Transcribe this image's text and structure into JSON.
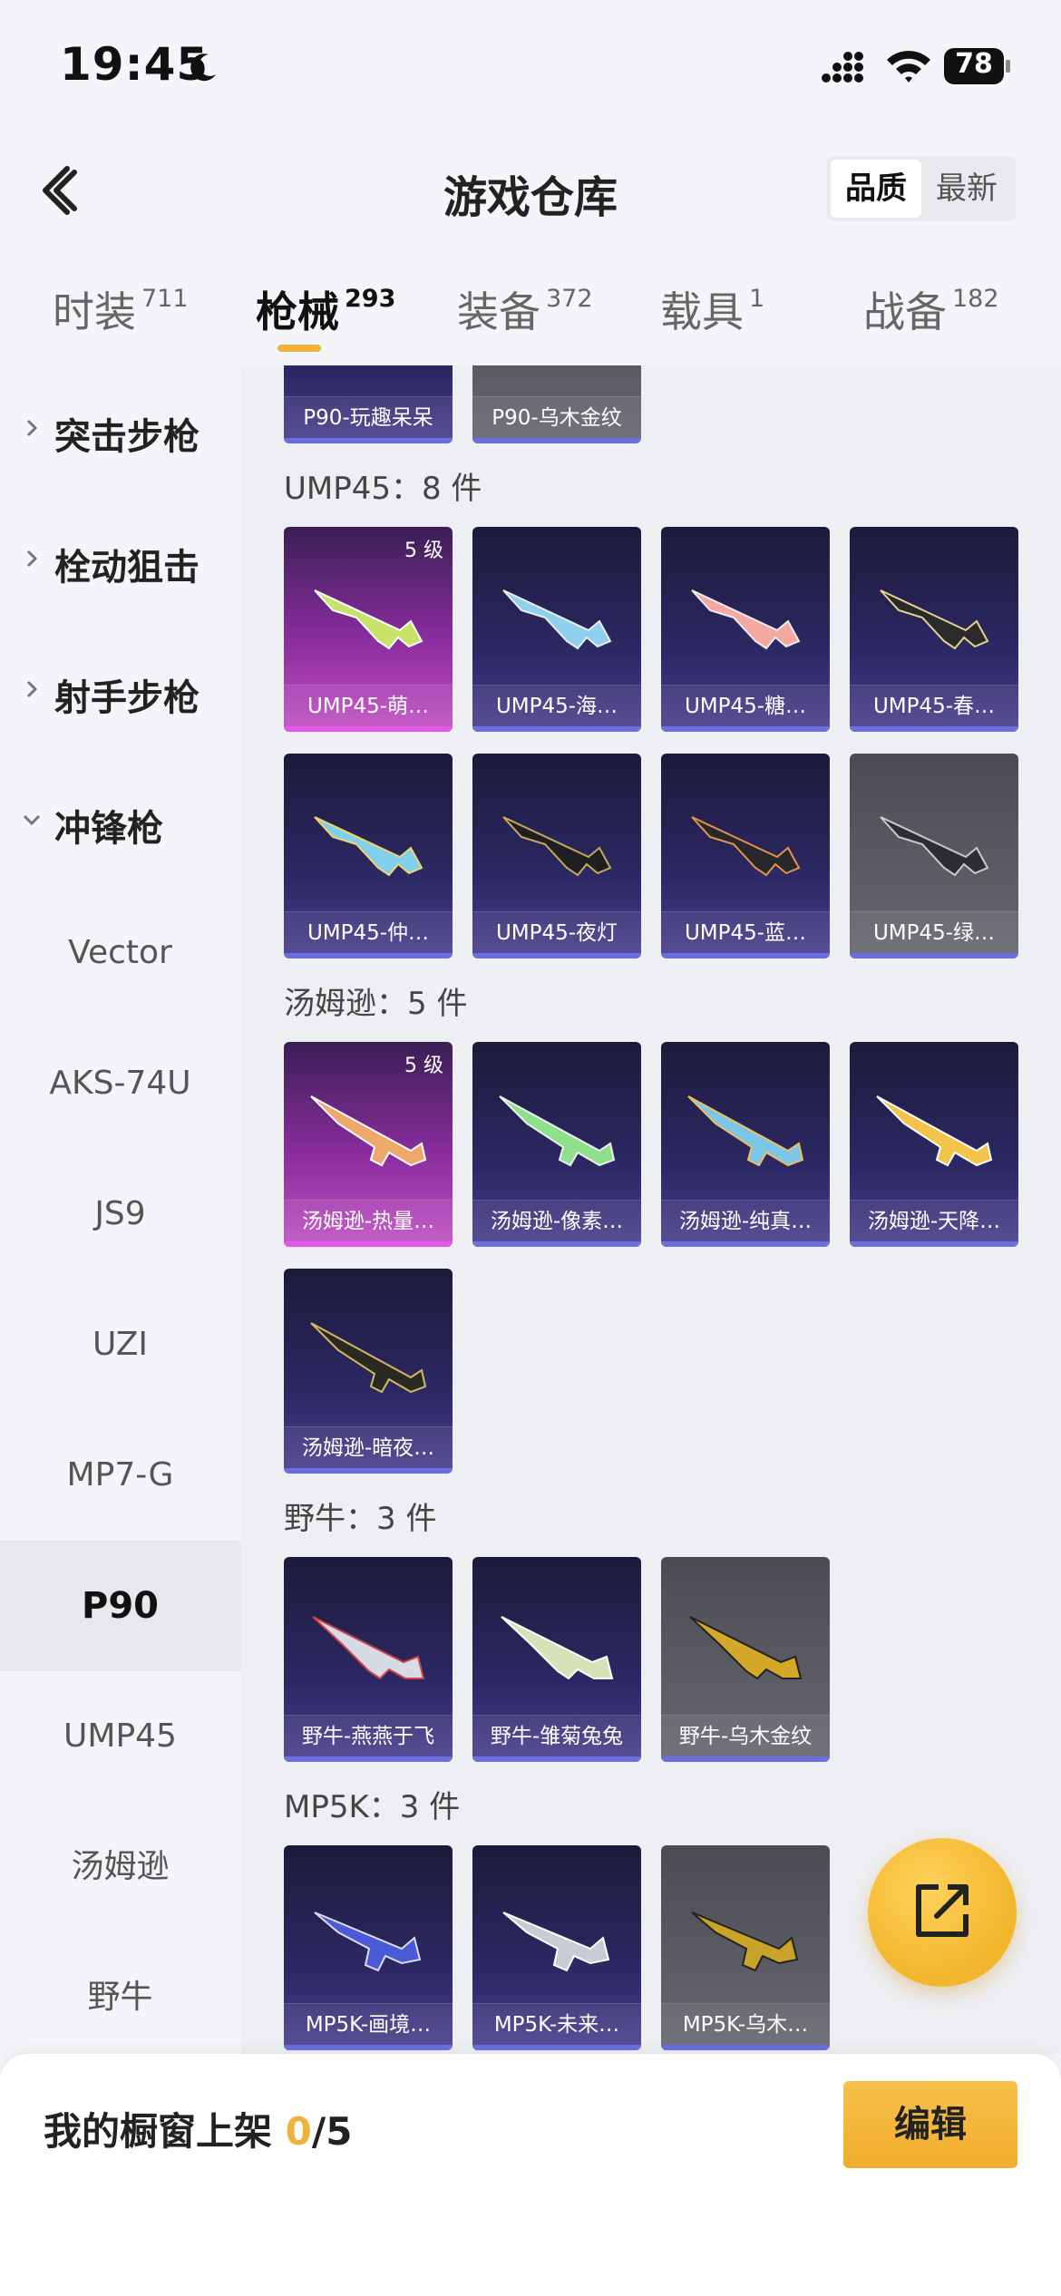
{
  "status_bar": {
    "time": "19:45",
    "battery": "78"
  },
  "header": {
    "title": "游戏仓库",
    "sort_options": [
      "品质",
      "最新"
    ]
  },
  "tabs": [
    {
      "label": "时装",
      "count": "711"
    },
    {
      "label": "枪械",
      "count": "293"
    },
    {
      "label": "装备",
      "count": "372"
    },
    {
      "label": "载具",
      "count": "1"
    },
    {
      "label": "战备",
      "count": "182"
    }
  ],
  "sidebar": {
    "categories": [
      "突击步枪",
      "栓动狙击",
      "射手步枪",
      "冲锋枪"
    ],
    "subcategories": [
      "Vector",
      "AKS-74U",
      "JS9",
      "UZI",
      "MP7-G",
      "P90",
      "UMP45",
      "汤姆逊",
      "野牛"
    ]
  },
  "main": {
    "p90_tail": [
      "P90-玩趣呆呆",
      "P90-乌木金纹"
    ],
    "sections": [
      {
        "title": "UMP45：8 件",
        "items": [
          "UMP45-萌…",
          "UMP45-海…",
          "UMP45-糖…",
          "UMP45-春…",
          "UMP45-仲…",
          "UMP45-夜灯",
          "UMP45-蓝…",
          "UMP45-绿…"
        ],
        "level_badge": "5 级"
      },
      {
        "title": "汤姆逊：5 件",
        "items": [
          "汤姆逊-热量…",
          "汤姆逊-像素…",
          "汤姆逊-纯真…",
          "汤姆逊-天降…",
          "汤姆逊-暗夜…"
        ],
        "level_badge": "5 级"
      },
      {
        "title": "野牛：3 件",
        "items": [
          "野牛-燕燕于飞",
          "野牛-雏菊兔兔",
          "野牛-乌木金纹"
        ]
      },
      {
        "title": "MP5K：3 件",
        "items": [
          "MP5K-画境…",
          "MP5K-未来…",
          "MP5K-乌木…"
        ]
      }
    ]
  },
  "bottom_bar": {
    "label": "我的橱窗上架 ",
    "count": "0",
    "total": "/5",
    "edit_label": "编辑"
  },
  "colors": {
    "accent": "#f0b23d",
    "card_purple": "#2c2864",
    "card_pink": "#c250c4",
    "card_grey": "#5b5c64"
  }
}
